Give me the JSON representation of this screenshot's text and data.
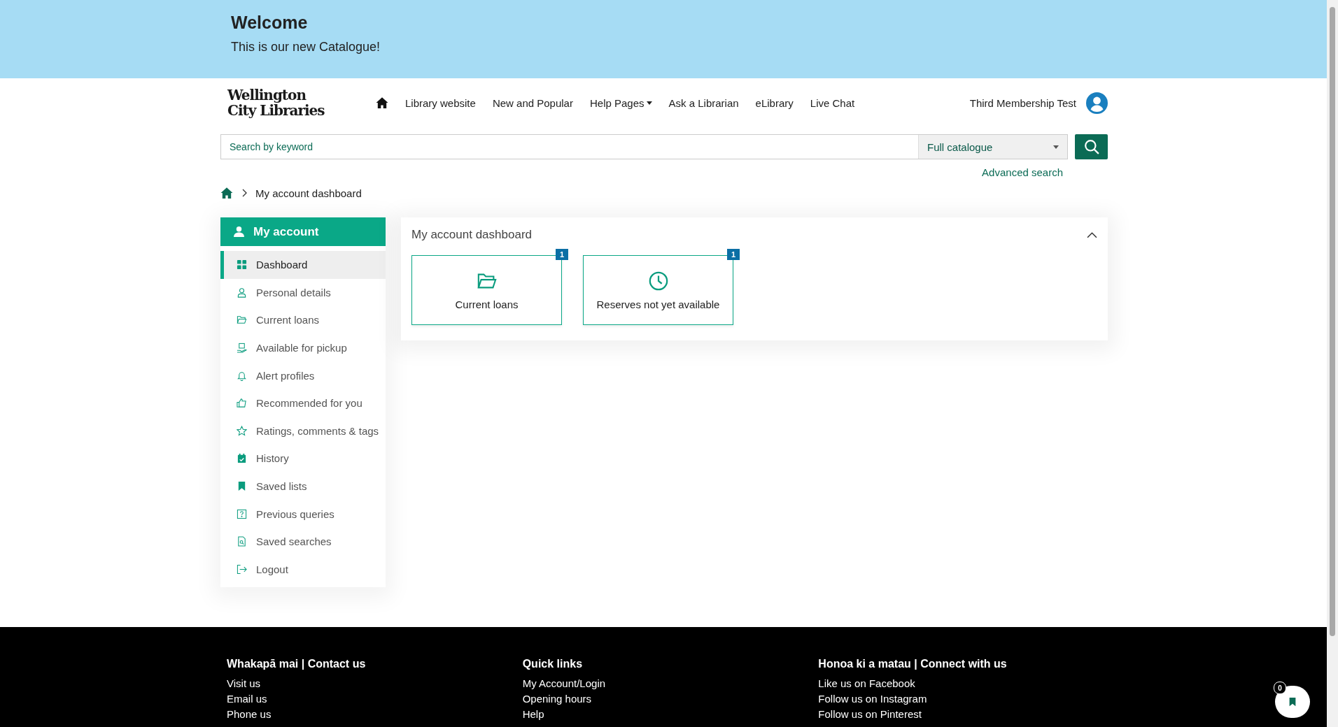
{
  "banner": {
    "title": "Welcome",
    "text": "This is our new Catalogue!"
  },
  "logo": {
    "line_1": "Wellington",
    "line_2": "City Libraries"
  },
  "nav": [
    {
      "label": "Library website",
      "dropdown": false
    },
    {
      "label": "New and Popular",
      "dropdown": false
    },
    {
      "label": "Help Pages",
      "dropdown": true
    },
    {
      "label": "Ask a Librarian",
      "dropdown": false
    },
    {
      "label": "eLibrary",
      "dropdown": false
    },
    {
      "label": "Live Chat",
      "dropdown": false
    }
  ],
  "user": {
    "name": "Third Membership Test"
  },
  "search": {
    "placeholder": "Search by keyword",
    "scope": "Full catalogue",
    "advanced": "Advanced search"
  },
  "breadcrumb": {
    "current": "My account dashboard"
  },
  "sidebar": {
    "title": "My account",
    "items": [
      {
        "label": "Dashboard",
        "kind": "grid",
        "selected": true
      },
      {
        "label": "Personal details",
        "kind": "person",
        "selected": false
      },
      {
        "label": "Current loans",
        "kind": "folder",
        "selected": false
      },
      {
        "label": "Available for pickup",
        "kind": "pickup",
        "selected": false
      },
      {
        "label": "Alert profiles",
        "kind": "bell",
        "selected": false
      },
      {
        "label": "Recommended for you",
        "kind": "thumb",
        "selected": false
      },
      {
        "label": "Ratings, comments & tags",
        "kind": "star",
        "selected": false
      },
      {
        "label": "History",
        "kind": "calendar",
        "selected": false
      },
      {
        "label": "Saved lists",
        "kind": "bookmark",
        "selected": false
      },
      {
        "label": "Previous queries",
        "kind": "question",
        "selected": false
      },
      {
        "label": "Saved searches",
        "kind": "doc",
        "selected": false
      },
      {
        "label": "Logout",
        "kind": "logout",
        "selected": false
      }
    ]
  },
  "dashboard": {
    "title": "My account dashboard",
    "expanded": true,
    "tiles": [
      {
        "label": "Current loans",
        "kind": "folder",
        "count": "1"
      },
      {
        "label": "Reserves not yet available",
        "kind": "clock",
        "count": "1"
      }
    ]
  },
  "footer": {
    "columns": [
      {
        "heading": "Whakapā mai | Contact us",
        "links": [
          "Visit us",
          "Email us",
          "Phone us"
        ]
      },
      {
        "heading": "Quick links",
        "links": [
          "My Account/Login",
          "Opening hours",
          "Help"
        ]
      },
      {
        "heading": "Honoa ki a matau | Connect with us",
        "links": [
          "Like us on Facebook",
          "Follow us on Instagram",
          "Follow us on Pinterest"
        ]
      }
    ]
  },
  "saved_button": {
    "count": "0"
  }
}
